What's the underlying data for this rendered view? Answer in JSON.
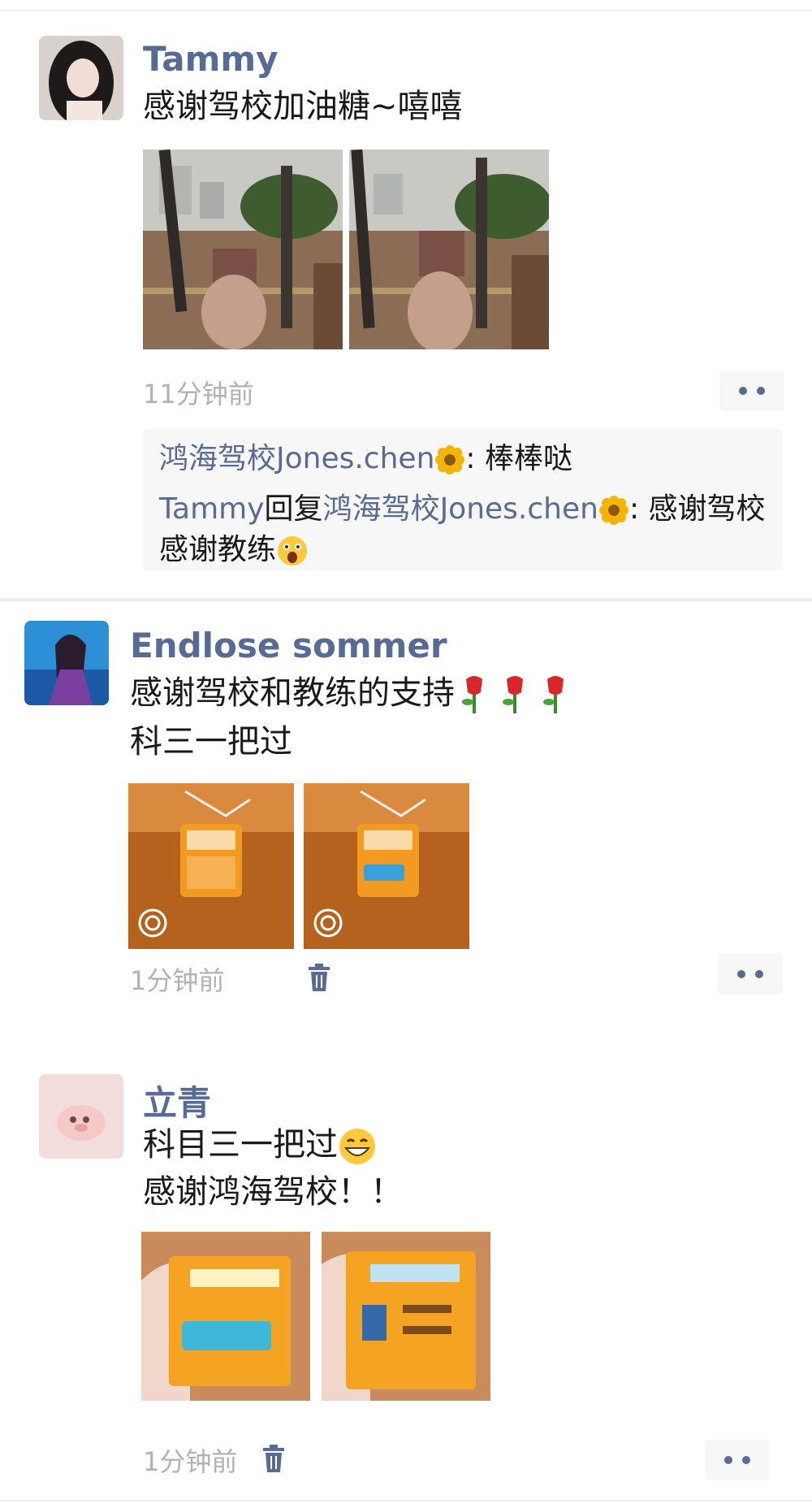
{
  "posts": [
    {
      "name": "Tammy",
      "text_lines": [
        "感谢驾校加油糖~嘻嘻"
      ],
      "time": "11分钟前",
      "comments": [
        {
          "author": "鸿海驾校Jones.chen",
          "text": ": 棒棒哒"
        },
        {
          "author": "Tammy",
          "reply_word": "回复",
          "reply_to": "鸿海驾校Jones.chen",
          "text_line1": ": 感谢驾校",
          "text_line2": "感谢教练"
        }
      ]
    },
    {
      "name": "Endlose sommer",
      "text_lines": [
        "感谢驾校和教练的支持",
        "科三一把过"
      ],
      "time": "1分钟前"
    },
    {
      "name": "立青",
      "text_lines": [
        "科目三一把过",
        "感谢鸿海驾校！！"
      ],
      "time": "1分钟前"
    }
  ],
  "colors": {
    "link": "#576b95",
    "time": "#b2b2b2",
    "background": "#ffffff",
    "comment_bg": "#f7f7f7"
  }
}
